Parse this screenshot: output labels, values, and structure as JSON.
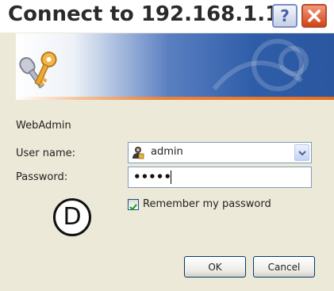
{
  "window": {
    "title": "Connect to 192.168.1.1",
    "help_glyph": "?",
    "close_icon": "close-icon"
  },
  "colors": {
    "titlebar_bg": "#ffffff",
    "dialog_bg": "#ece9d8",
    "banner_blue": "#2e5da8",
    "banner_orange": "#e56f1f",
    "close_red": "#d14419",
    "field_border": "#7f9db9",
    "checkbox_check": "#21a121"
  },
  "banner": {
    "icon": "keys-icon"
  },
  "form": {
    "realm": "WebAdmin",
    "username_label": "User name:",
    "username_value": "admin",
    "username_icon": "user-icon",
    "password_label": "Password:",
    "password_value": "•••••",
    "remember_label": "Remember my password",
    "remember_checked": true
  },
  "annotation": {
    "letter": "D"
  },
  "buttons": {
    "ok": "OK",
    "cancel": "Cancel"
  }
}
